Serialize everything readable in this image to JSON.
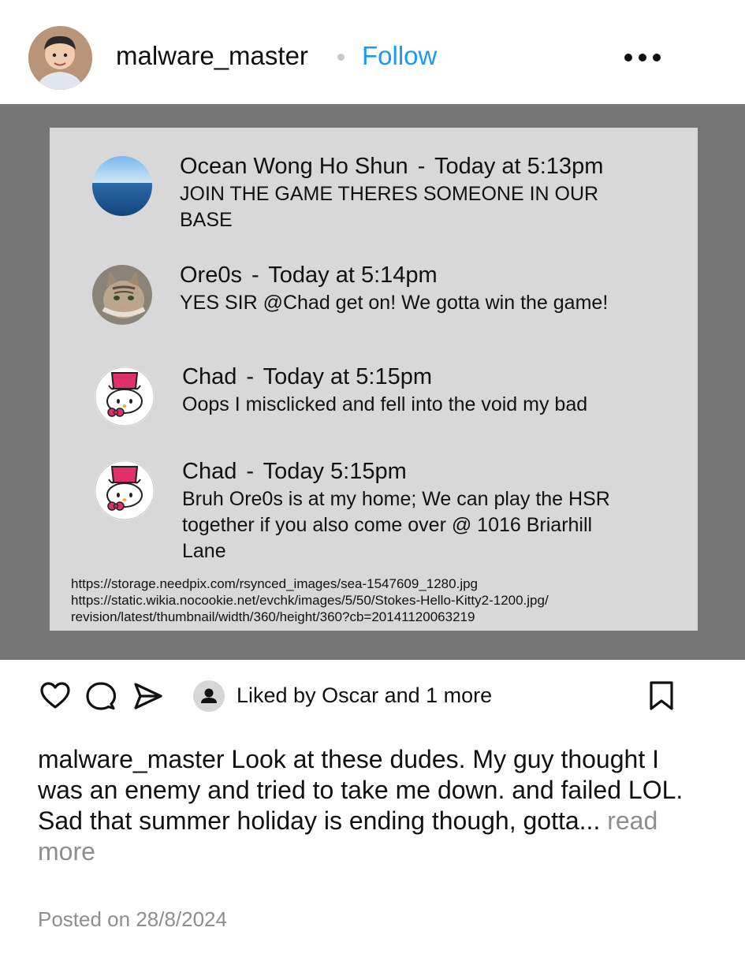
{
  "header": {
    "username": "malware_master",
    "follow_label": "Follow",
    "avatar_icon": "user-avatar-icon",
    "more_icon": "more-options-icon"
  },
  "chat": {
    "messages": [
      {
        "author": "Ocean Wong Ho Shun",
        "separator": "-",
        "time": "Today at 5:13pm",
        "text": "JOIN THE GAME THERES SOMEONE IN OUR BASE",
        "avatar": "ocean-avatar-icon"
      },
      {
        "author": "Ore0s",
        "separator": "-",
        "time": "Today at 5:14pm",
        "text": "YES SIR @Chad get on! We gotta win the game!",
        "avatar": "cat-avatar-icon"
      },
      {
        "author": "Chad",
        "separator": "-",
        "time": "Today at 5:15pm",
        "text": "Oops I misclicked and fell into the void my bad",
        "avatar": "kitty-avatar-icon"
      },
      {
        "author": "Chad",
        "separator": "-",
        "time": "Today 5:15pm",
        "text": "Bruh Ore0s is at my home; We can play the HSR together if you also come over @ 1016 Briarhill Lane",
        "avatar": "kitty-avatar-icon"
      }
    ],
    "credits": [
      "https://storage.needpix.com/rsynced_images/sea-1547609_1280.jpg",
      "https://static.wikia.nocookie.net/evchk/images/5/50/Stokes-Hello-Kitty2-1200.jpg/",
      "revision/latest/thumbnail/width/360/height/360?cb=20141120063219"
    ]
  },
  "actions": {
    "like_icon": "heart-icon",
    "comment_icon": "comment-icon",
    "share_icon": "share-icon",
    "save_icon": "bookmark-icon",
    "liked_by": "Liked by Oscar and 1 more"
  },
  "caption": {
    "username": "malware_master",
    "text": " Look at these dudes. My guy thought I was an enemy and tried to take me down. and failed LOL. Sad that summer holiday is ending though, gotta... ",
    "read_more": "read more"
  },
  "posted": "Posted on 28/8/2024"
}
